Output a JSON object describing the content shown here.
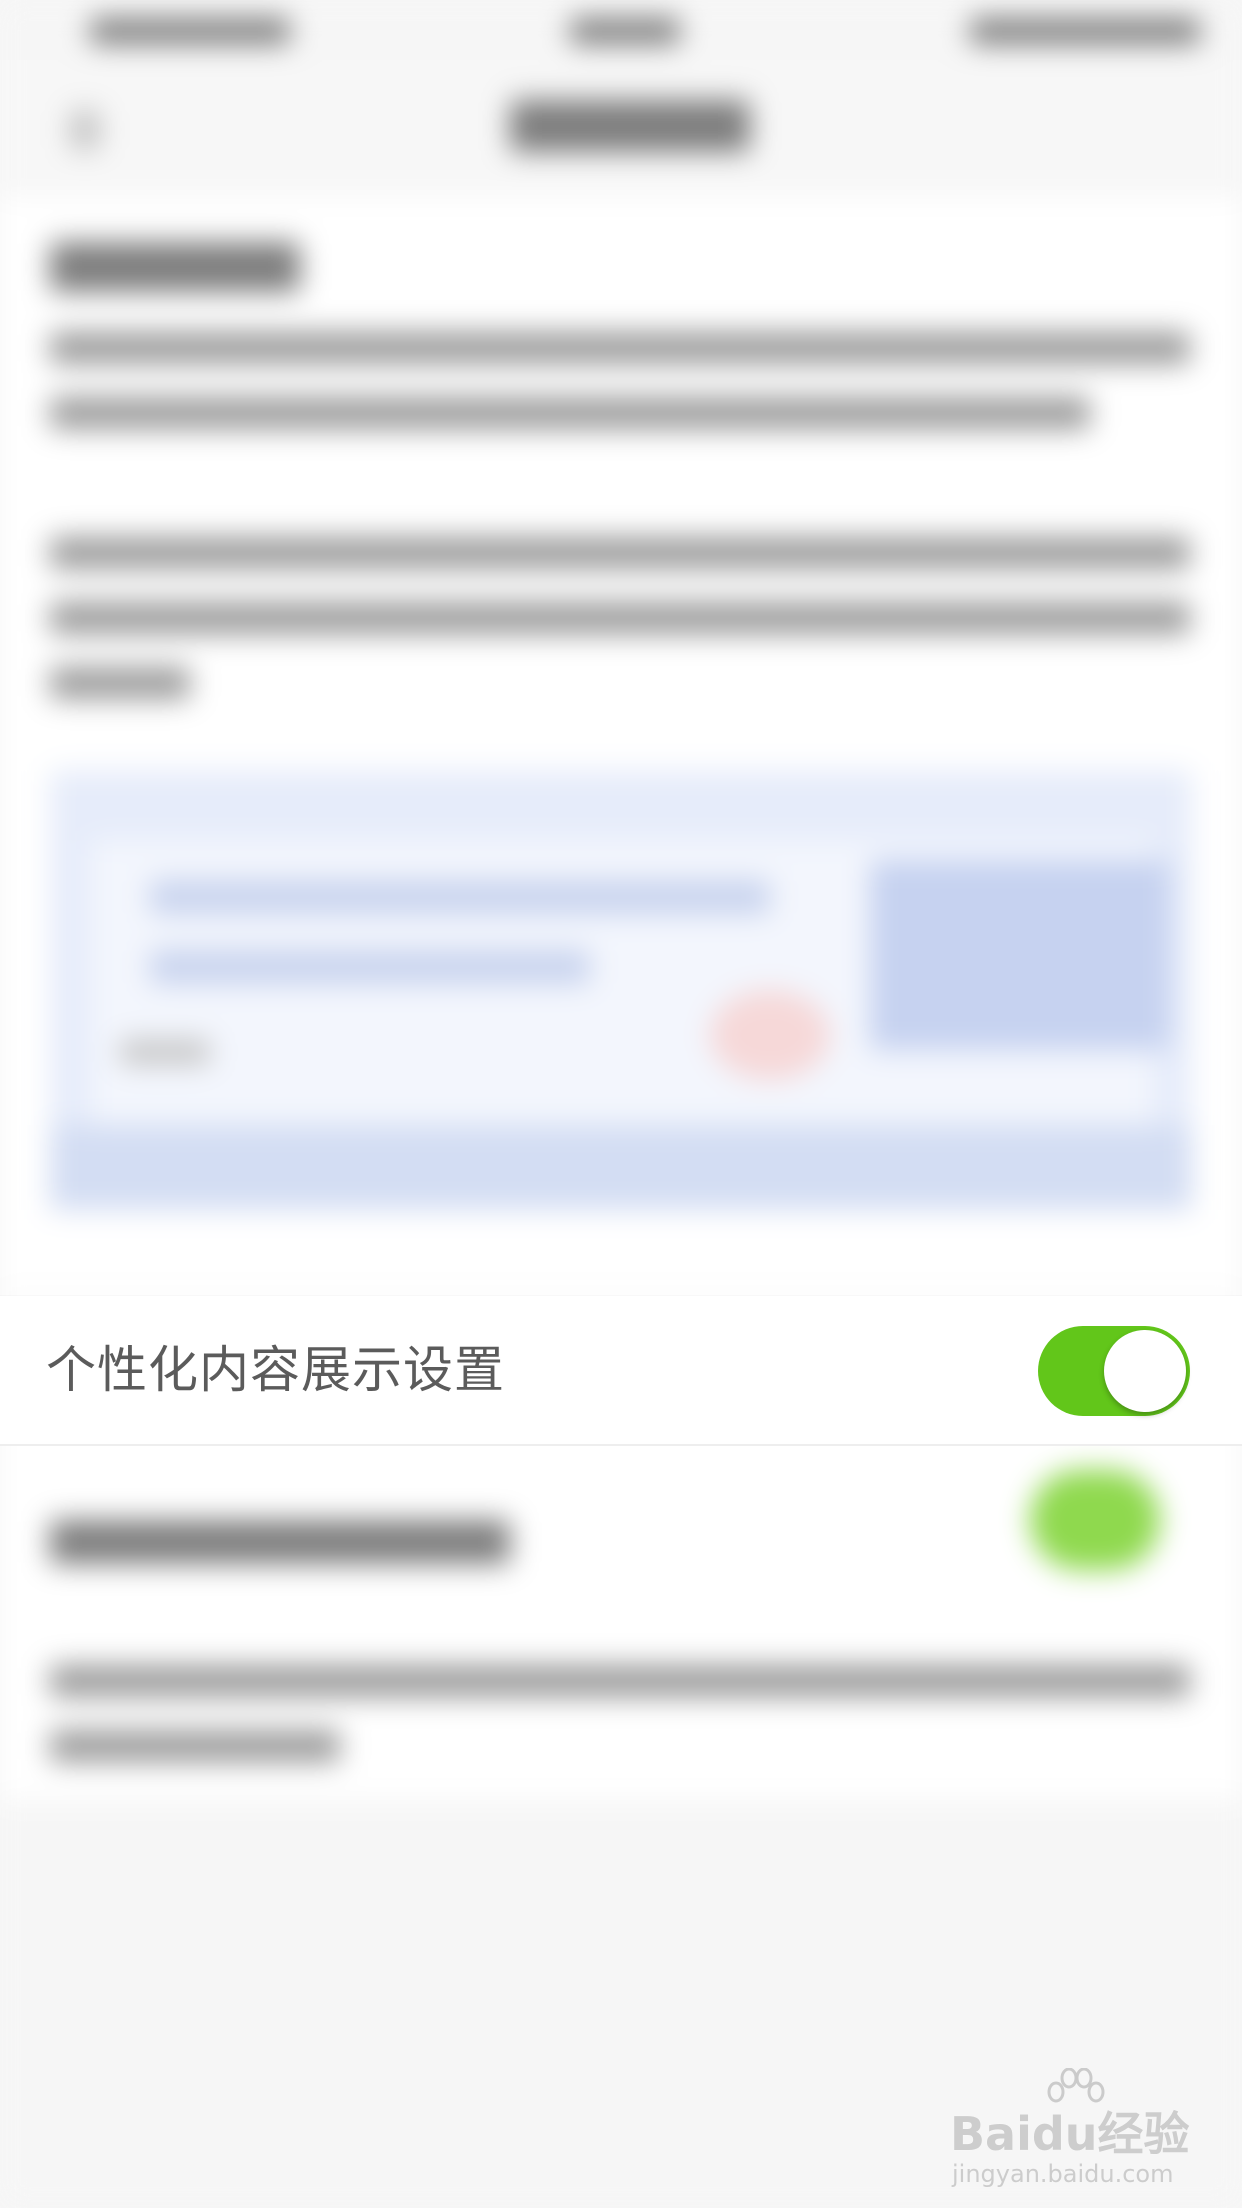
{
  "setting": {
    "label": "个性化内容展示设置",
    "enabled": true
  },
  "colors": {
    "toggle_on": "#62c61a",
    "label_text": "#5b5b5b",
    "row_background": "#ffffff",
    "page_background": "#f7f7f7"
  },
  "watermark": {
    "logo_text": "Baidu经验",
    "url": "jingyan.baidu.com"
  }
}
